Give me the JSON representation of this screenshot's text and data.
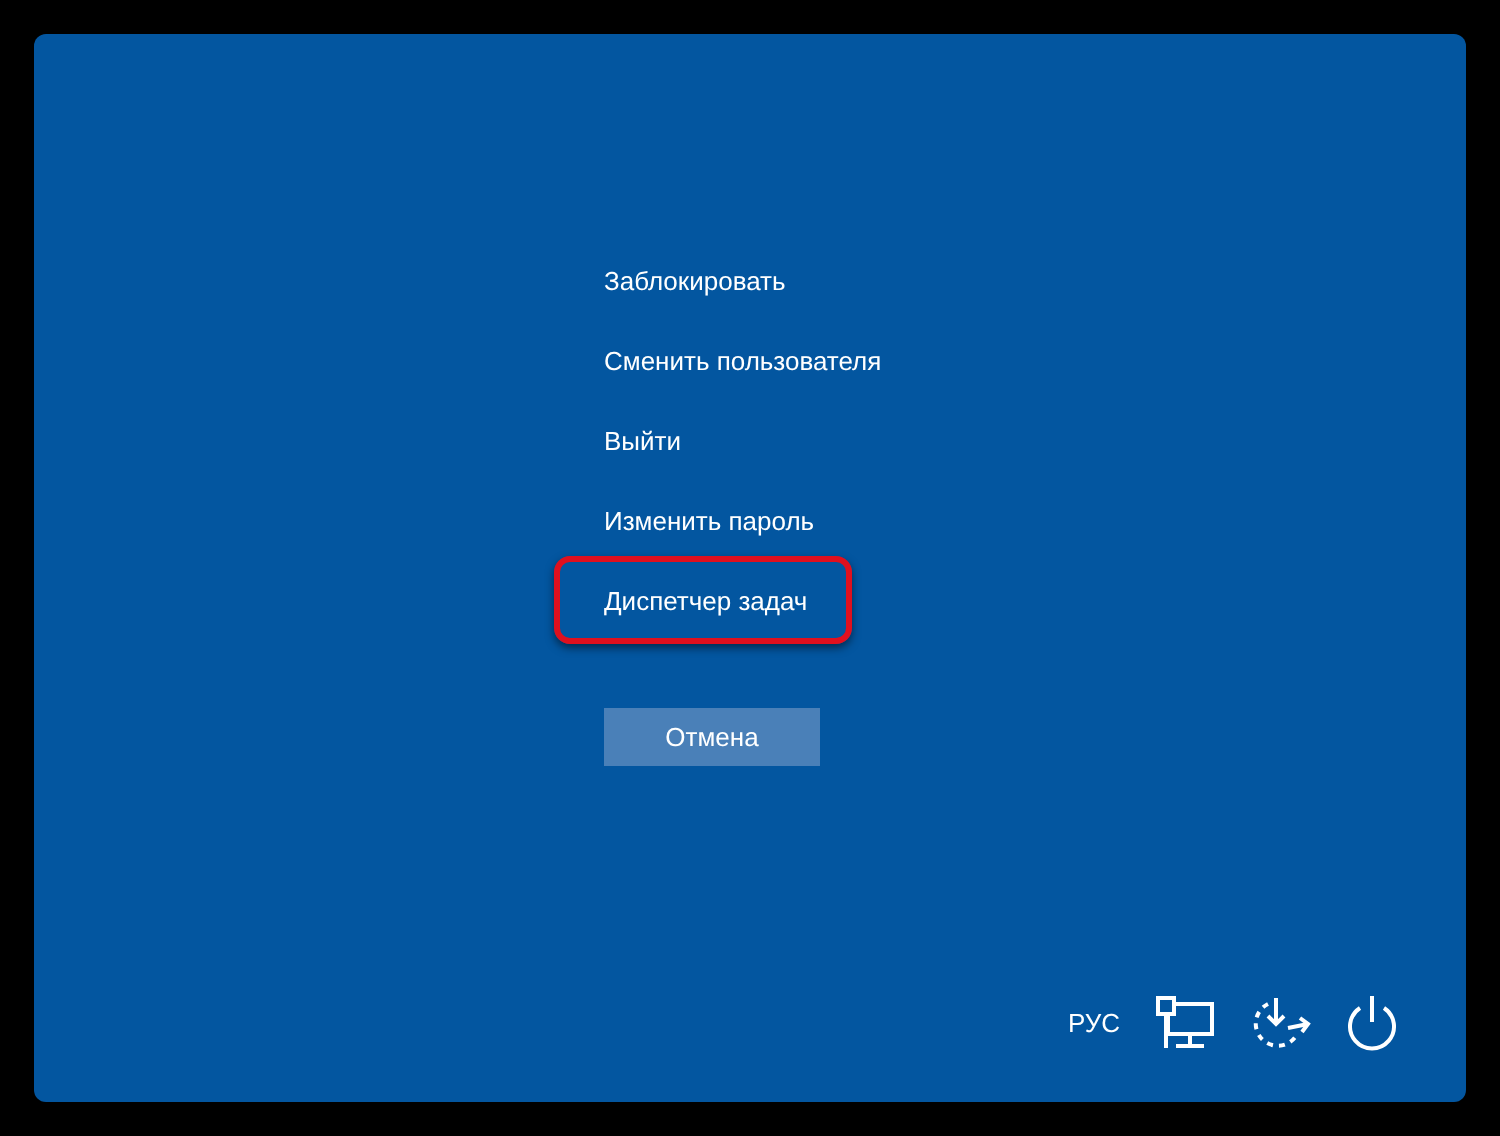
{
  "menu": [
    {
      "label": "Заблокировать",
      "highlighted": false
    },
    {
      "label": "Сменить пользователя",
      "highlighted": false
    },
    {
      "label": "Выйти",
      "highlighted": false
    },
    {
      "label": "Изменить пароль",
      "highlighted": false
    },
    {
      "label": "Диспетчер задач",
      "highlighted": true
    }
  ],
  "cancel_button": "Отмена",
  "tray": {
    "language": "РУС"
  }
}
